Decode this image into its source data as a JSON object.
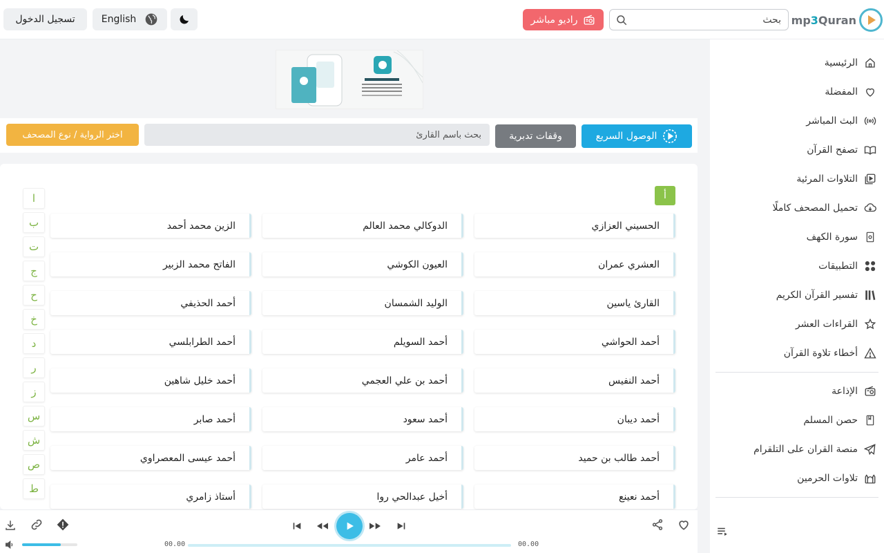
{
  "header": {
    "logo_text_1": "mp",
    "logo_text_2": "3",
    "logo_text_3": "Quran",
    "search_placeholder": "بحث",
    "radio_label": "راديو مباشر",
    "language_label": "English",
    "login_label": "تسجيل الدخول"
  },
  "sidebar": {
    "items": [
      {
        "label": "الرئيسية",
        "icon": "home-icon"
      },
      {
        "label": "المفضلة",
        "icon": "heart-icon"
      },
      {
        "label": "البث المباشر",
        "icon": "broadcast-icon"
      },
      {
        "label": "تصفح القرآن",
        "icon": "open-book-icon"
      },
      {
        "label": "التلاوات المرئية",
        "icon": "video-icon"
      },
      {
        "label": "تحميل المصحف كاملًا",
        "icon": "cloud-download-icon"
      },
      {
        "label": "سورة الكهف",
        "icon": "book-icon"
      },
      {
        "label": "التطبيقات",
        "icon": "apps-icon"
      },
      {
        "label": "تفسير القرآن الكريم",
        "icon": "library-icon"
      },
      {
        "label": "القراءات العشر",
        "icon": "star-icon"
      },
      {
        "label": "أخطاء تلاوة القرآن",
        "icon": "warning-icon"
      }
    ],
    "items2": [
      {
        "label": "الإذاعة",
        "icon": "radio-icon"
      },
      {
        "label": "حصن المسلم",
        "icon": "bookmark-icon"
      },
      {
        "label": "منصة القران على التلقرام",
        "icon": "telegram-icon"
      },
      {
        "label": "تلاوات الحرمين",
        "icon": "mosque-icon"
      }
    ]
  },
  "toolbar": {
    "quick_access": "الوصول السريع",
    "contemplation": "وقفات تدبرية",
    "reader_search_placeholder": "بحث باسم القارئ",
    "riwaya": "اختر الرواية / نوع المصحف"
  },
  "panel": {
    "current_letter": "أ",
    "alphabet": [
      "ا",
      "ب",
      "ت",
      "ج",
      "ح",
      "خ",
      "د",
      "ر",
      "ز",
      "س",
      "ش",
      "ص",
      "ط"
    ],
    "readers": [
      [
        "الحسيني العزازي",
        "الدوكالي محمد العالم",
        "الزين محمد أحمد"
      ],
      [
        "العشري عمران",
        "العيون الكوشي",
        "الفاتح محمد الزبير"
      ],
      [
        "القارئ ياسين",
        "الوليد الشمسان",
        "أحمد الحذيفي"
      ],
      [
        "أحمد الحواشي",
        "أحمد السويلم",
        "أحمد الطرابلسي"
      ],
      [
        "أحمد النفيس",
        "أحمد بن علي العجمي",
        "أحمد خليل شاهين"
      ],
      [
        "أحمد ديبان",
        "أحمد سعود",
        "أحمد صابر"
      ],
      [
        "أحمد طالب بن حميد",
        "أحمد عامر",
        "أحمد عيسى المعصراوي"
      ],
      [
        "أحمد نعينع",
        "أخيل عبدالحي روا",
        "أستاذ زامري"
      ]
    ]
  },
  "player": {
    "time_current": "00.00",
    "time_total": "00.00",
    "progress": 0,
    "volume": 0.7
  },
  "colors": {
    "accent": "#1ea9e1",
    "radio": "#f2676d",
    "riwaya": "#f2b441",
    "letters": "#7cb342"
  }
}
